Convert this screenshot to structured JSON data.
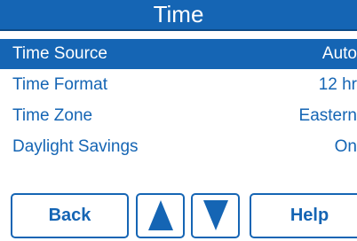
{
  "header": {
    "title": "Time",
    "background_color": "#1565b4",
    "text_color": "#ffffff"
  },
  "menu": {
    "selected_index": 0,
    "items": [
      {
        "label": "Time Source",
        "value": "Auto"
      },
      {
        "label": "Time Format",
        "value": "12 hr"
      },
      {
        "label": "Time Zone",
        "value": "Eastern"
      },
      {
        "label": "Daylight Savings",
        "value": "On"
      }
    ]
  },
  "buttons": {
    "back_label": "Back",
    "up_icon": "up-arrow-icon",
    "down_icon": "down-arrow-icon",
    "help_label": "Help"
  },
  "colors": {
    "accent": "#1565b4",
    "background": "#ffffff"
  }
}
